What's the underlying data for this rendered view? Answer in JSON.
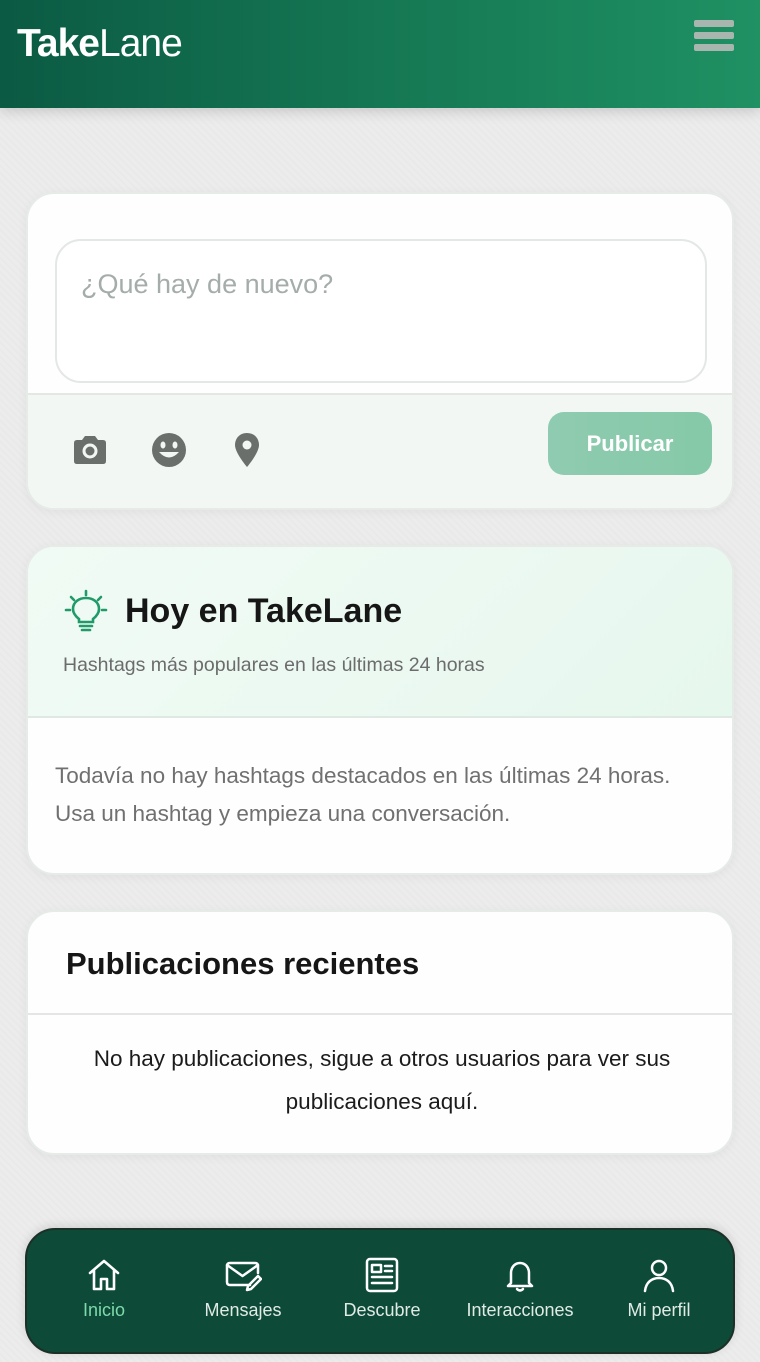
{
  "header": {
    "brand_bold": "Take",
    "brand_light": "Lane",
    "menu_icon": "hamburger-menu-icon"
  },
  "composer": {
    "placeholder": "¿Qué hay de nuevo?",
    "value": "",
    "icons": [
      "camera-icon",
      "emoji-icon",
      "location-pin-icon"
    ],
    "publish_label": "Publicar"
  },
  "today": {
    "icon": "lightbulb-icon",
    "title": "Hoy en TakeLane",
    "subtitle": "Hashtags más populares en las últimas 24 horas",
    "empty_line1": "Todavía no hay hashtags destacados en las últimas 24 horas.",
    "empty_line2": "Usa un hashtag y empieza una conversación."
  },
  "recent": {
    "title": "Publicaciones recientes",
    "empty_line1": "No hay publicaciones, sigue a otros usuarios para ver sus",
    "empty_line2": "publicaciones aquí."
  },
  "nav": {
    "items": [
      {
        "label": "Inicio",
        "icon": "home-icon",
        "active": true
      },
      {
        "label": "Mensajes",
        "icon": "messages-icon",
        "active": false
      },
      {
        "label": "Descubre",
        "icon": "newspaper-icon",
        "active": false
      },
      {
        "label": "Interacciones",
        "icon": "bell-icon",
        "active": false
      },
      {
        "label": "Mi perfil",
        "icon": "user-icon",
        "active": false
      }
    ]
  },
  "colors": {
    "header_start": "#0b5a43",
    "header_end": "#1f9163",
    "nav_bg": "#0d4a38",
    "accent": "#7ed9ab",
    "publish_button": "#8fcbb0"
  }
}
